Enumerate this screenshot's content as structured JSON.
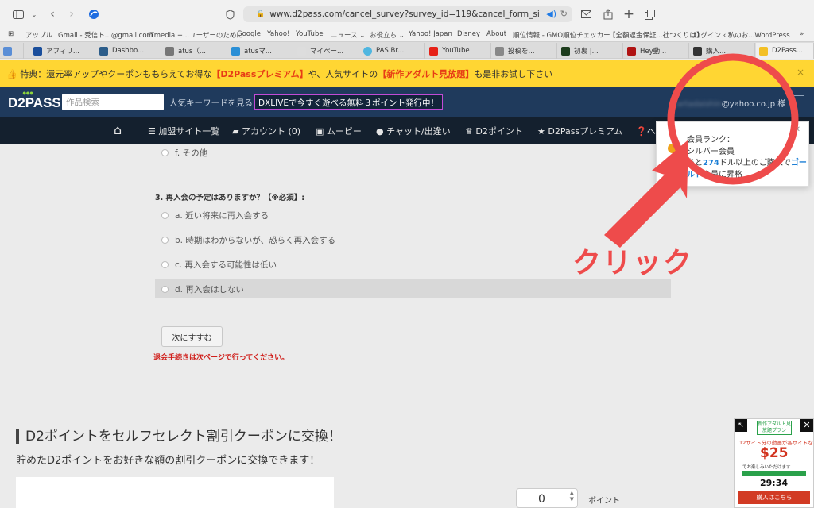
{
  "browser": {
    "url": "www.d2pass.com/cancel_survey?survey_id=119&cancel_form_site_id=2000263",
    "bookmarks": [
      "アップル",
      "Gmail - 受信ト...@gmail.com",
      "ITmedia +...ユーザーのために",
      "Google",
      "Yahoo!",
      "YouTube",
      "ニュース ⌄",
      "お役立ち ⌄",
      "Yahoo! Japan",
      "Disney",
      "About",
      "順位情報 - GMO順位チェッカー",
      "【全額返金保証...社つくりば】",
      "ログイン ‹ 私のお...WordPress"
    ],
    "tabs": [
      "アフィリ...",
      "Dashbo...",
      "atus（...",
      "atusマ...",
      "マイペー...",
      "PAS Br...",
      "YouTube",
      "投稿を...",
      "初裏 |...",
      "Hey動...",
      "購入...",
      "D2Pass..."
    ],
    "tab_colors": [
      "#1b4f9c",
      "#2c5d8a",
      "#777777",
      "#2a8fd6",
      "#dddddd",
      "#4fb6e0",
      "#e62117",
      "#888888",
      "#1d3d1d",
      "#b01414",
      "#333333",
      "#f3c026"
    ]
  },
  "promo": {
    "prefix": "特典：還元率アップやクーポンももらえてお得な",
    "premium": "【D2Passプレミアム】",
    "mid": "や、人気サイトの",
    "unlimited": "【新作アダルト見放題】",
    "suffix": "も是非お試し下さい",
    "close": "×"
  },
  "header": {
    "logo": "D2PASS",
    "search_placeholder": "作品検索",
    "popular_keywords": "人気キーワードを見る",
    "dxlive_banner": "DXLIVEで今すぐ遊べる無料３ポイント発行中！",
    "user_email_hidden": "cartadaishin",
    "user_email_domain": "@yahoo.co.jp",
    "user_suffix": "様"
  },
  "nav": {
    "items": [
      "加盟サイト一覧",
      "アカウント (0)",
      "ムービー",
      "チャット/出逢い",
      "D2ポイント",
      "D2Passプレミアム",
      "ヘ"
    ]
  },
  "survey": {
    "option_f": "f. その他",
    "question3": "3. 再入会の予定はありますか？【※必須】:",
    "options": [
      "a. 近い将来に再入会する",
      "b. 時期はわからないが、恐らく再入会する",
      "c. 再入会する可能性は低い",
      "d. 再入会はしない"
    ],
    "next_button": "次にすすむ",
    "warning": "退会手続きは次ページで行ってください。"
  },
  "points_section": {
    "title": "D2ポイントをセルフセレクト割引クーポンに交換！",
    "subtitle": "貯めたD2ポイントをお好きな額の割引クーポンに交換できます！",
    "input_value": "0",
    "unit": "ポイント"
  },
  "dropdown": {
    "rank_label": "会員ランク：",
    "rank_value": "シルバー会員",
    "line3_prefix": "あと",
    "line3_amount": "274",
    "line3_mid": "ドル以上のご購入で",
    "line3_gold": "ゴー",
    "line4_gold": "ルド",
    "line4_suffix": "会員に昇格"
  },
  "annotation": {
    "click_label": "クリック",
    "color": "#ee4b4b"
  },
  "ad": {
    "logo": "新作アダルト見放題プラン",
    "line1": "12サイト分の動画が各サイトなら",
    "price": "$25",
    "line2": "でお楽しみいただけます",
    "timer": "29:34",
    "buy": "購入はこちら"
  }
}
